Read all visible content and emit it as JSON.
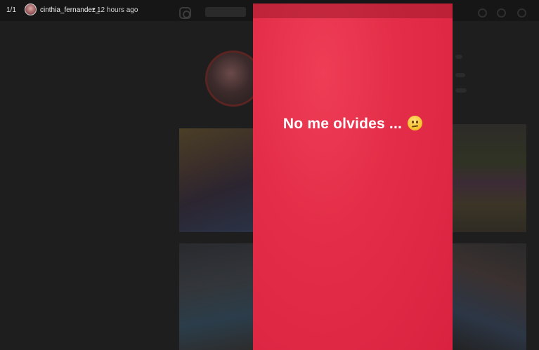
{
  "story_viewer": {
    "counter": "1/1",
    "username": "cinthia_fernandez_",
    "separator": "•",
    "time_ago": "12 hours ago",
    "story_text": "No me olvides ...",
    "emoji_icon": "confused-face-icon",
    "story_color": "#e42e49"
  }
}
